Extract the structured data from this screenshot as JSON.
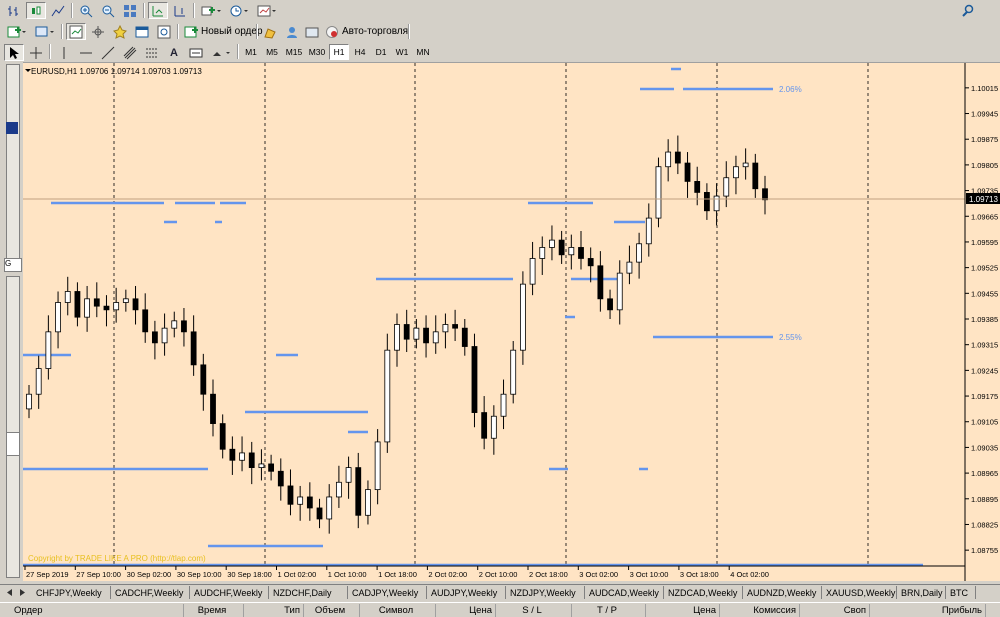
{
  "toolbar1": {
    "icons": [
      "chart-bars-icon",
      "candles-icon",
      "line-chart-icon",
      "zoom-in-icon",
      "zoom-out-icon",
      "tile-icon",
      "autoscroll-icon",
      "chart-shift-icon",
      "indicators-icon",
      "periods-icon",
      "templates-icon"
    ],
    "search_icon": "search-icon"
  },
  "toolbar2": {
    "new_order_label": "Новый ордер",
    "autotrading_label": "Авто-торговля"
  },
  "toolbar3": {
    "timeframes": [
      "M1",
      "M5",
      "M15",
      "M30",
      "H1",
      "H4",
      "D1",
      "W1",
      "MN"
    ],
    "active_timeframe": "H1",
    "text_tool_label": "A"
  },
  "chart": {
    "header": "EURUSD,H1  1.09706 1.09714 1.09703 1.09713",
    "copyright": "Copyright by TRADE LIKE A PRO (http://tlap.com)",
    "current_price": "1.09713",
    "levels": [
      {
        "label": "2.06%"
      },
      {
        "label": "2.55%"
      }
    ],
    "colors": {
      "background": "#ffe4c4",
      "level": "#6495ed",
      "grid": "#000000",
      "candle_up": "#ffffff",
      "candle_down": "#000000"
    }
  },
  "chart_data": {
    "type": "candlestick",
    "symbol": "EURUSD",
    "timeframe": "H1",
    "y_ticks": [
      "1.10015",
      "1.09945",
      "1.09875",
      "1.09805",
      "1.09735",
      "1.09665",
      "1.09595",
      "1.09525",
      "1.09455",
      "1.09385",
      "1.09315",
      "1.09245",
      "1.09175",
      "1.09105",
      "1.09035",
      "1.08965",
      "1.08895",
      "1.08825",
      "1.08755"
    ],
    "ylim": [
      1.0872,
      1.1005
    ],
    "x_labels": [
      "27 Sep 2019",
      "27 Sep 10:00",
      "30 Sep 02:00",
      "30 Sep 10:00",
      "30 Sep 18:00",
      "1 Oct 02:00",
      "1 Oct 10:00",
      "1 Oct 18:00",
      "2 Oct 02:00",
      "2 Oct 10:00",
      "2 Oct 18:00",
      "3 Oct 02:00",
      "3 Oct 10:00",
      "3 Oct 18:00",
      "4 Oct 02:00"
    ],
    "last_price": 1.09713,
    "close_path": [
      1.0918,
      1.0925,
      1.0935,
      1.0943,
      1.0946,
      1.0939,
      1.0944,
      1.0942,
      1.0941,
      1.0943,
      1.0944,
      1.0941,
      1.0935,
      1.0932,
      1.0936,
      1.0938,
      1.0935,
      1.0926,
      1.0918,
      1.091,
      1.0903,
      1.09,
      1.0902,
      1.0898,
      1.0899,
      1.0897,
      1.0893,
      1.0888,
      1.089,
      1.0887,
      1.0884,
      1.089,
      1.0894,
      1.0898,
      1.0885,
      1.0892,
      1.0905,
      1.093,
      1.0937,
      1.0933,
      1.0936,
      1.0932,
      1.0935,
      1.0937,
      1.0936,
      1.0931,
      1.0913,
      1.0906,
      1.0912,
      1.0918,
      1.093,
      1.0948,
      1.0955,
      1.0958,
      1.096,
      1.0956,
      1.0958,
      1.0955,
      1.0953,
      1.0944,
      1.0941,
      1.0951,
      1.0954,
      1.0959,
      1.0966,
      1.098,
      1.0984,
      1.0981,
      1.0976,
      1.0973,
      1.0968,
      1.0972,
      1.0977,
      1.098,
      1.0981,
      1.0974,
      1.0971
    ]
  },
  "symbol_tabs": [
    "CHFJPY,Weekly",
    "CADCHF,Weekly",
    "AUDCHF,Weekly",
    "NZDCHF,Daily",
    "CADJPY,Weekly",
    "AUDJPY,Weekly",
    "NZDJPY,Weekly",
    "AUDCAD,Weekly",
    "NZDCAD,Weekly",
    "AUDNZD,Weekly",
    "XAUUSD,Weekly",
    "BRN,Daily",
    "BTC"
  ],
  "terminal_columns": [
    "Ордер",
    "Время",
    "Тип",
    "Объем",
    "Символ",
    "Цена",
    "S / L",
    "T / P",
    "Цена",
    "Комиссия",
    "Своп",
    "Прибыль"
  ]
}
